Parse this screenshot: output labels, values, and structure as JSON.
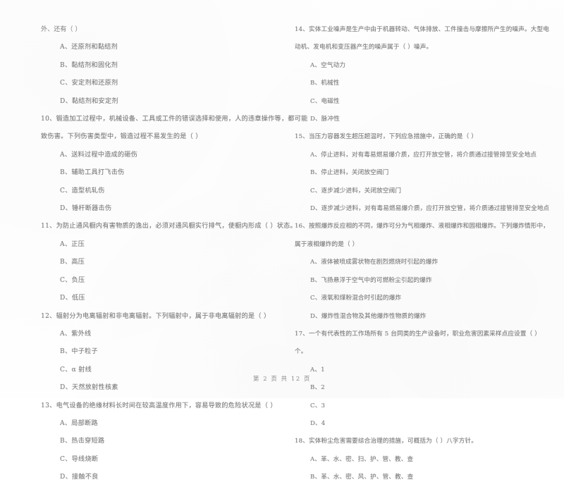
{
  "document": {
    "type": "scanned-exam-paper",
    "language": "zh-CN",
    "page_label": "第 2 页 共 12 页",
    "ink_color": "#7e7e7e",
    "paper_color": "#fefefe"
  },
  "left_column": {
    "carryover": {
      "text": "外、还有（      ）",
      "options": [
        "A、还原剂和黏结剂",
        "B、黏结剂和固化剂",
        "C、安定剂和还原剂",
        "D、黏结剂和安定剂"
      ]
    },
    "questions": [
      {
        "number": "10",
        "stem_lines": [
          "10、锻造加工过程中，机械设备、工具或工件的错误选择和使用，人的违章操作等，都可能",
          "致伤害。下列伤害类型中，锻造过程不易发生的是（      ）"
        ],
        "options": [
          "A、送料过程中造成的砸伤",
          "B、辅助工具打飞击伤",
          "C、造型机轧伤",
          "D、锤杆断器击伤"
        ]
      },
      {
        "number": "11",
        "stem_lines": [
          "11、为防止通风橱内有害物质的逸出，必须对通风橱实行排气，使橱内形成（     ）状态。"
        ],
        "options": [
          "A、正压",
          "B、高压",
          "C、负压",
          "D、低压"
        ]
      },
      {
        "number": "12",
        "stem_lines": [
          "12、辐射分为电离辐射和非电离辐射。下列辐射中，属于非电离辐射的是（      ）"
        ],
        "options": [
          "A、紫外线",
          "B、中子粒子",
          "C、α 射线",
          "D、天然放射性核素"
        ]
      },
      {
        "number": "13",
        "stem_lines": [
          "13、电气设备的绝缘材料长时间在较高温度作用下，容易导致的危险状况是（      ）"
        ],
        "options": [
          "A、局部断路",
          "B、热击穿短路",
          "C、导线烧断",
          "D、接触不良"
        ]
      }
    ]
  },
  "right_column": {
    "questions": [
      {
        "number": "14",
        "stem_lines": [
          "14、实体工业噪声是生产中由于机器转动、气体排放、工件撞击与摩擦所产生的噪声。大型电",
          "动机、发电机和变压器产生的噪声属于（     ）噪声。"
        ],
        "options": [
          "A、空气动力",
          "B、机械性",
          "C、电磁性",
          "D、脉冲性"
        ]
      },
      {
        "number": "15",
        "stem_lines": [
          "15、当压力容器发生超压超温时，下列应急措施中，正确的是（     ）"
        ],
        "options": [
          "A、停止进料，对有毒易燃易爆介质，应打开放空管，将介质通过接管排至安全地点",
          "B、停止进料，关闭放空阀门",
          "C、逐步减少进料，关闭放空阀门",
          "D、逐步减少进料，对有毒易燃易爆介质，应打开放空管，将介质通过接管排至安全地点"
        ]
      },
      {
        "number": "16",
        "stem_lines": [
          "16、按照爆炸反应相的不同，爆炸可分为气相爆炸、液相爆炸和固相爆炸。下列爆炸情形中，",
          "属于液相爆炸的是（     ）"
        ],
        "options": [
          "A、液体被喷成雾状物在剧烈燃烧时引起的爆炸",
          "B、飞扬悬浮于空气中的可燃粉尘引起的爆炸",
          "C、液氧和煤粉混合时引起的爆炸",
          "D、爆炸性混合物及其他爆炸性物质的爆炸"
        ]
      },
      {
        "number": "17",
        "stem_lines": [
          "17、一个有代表性的工作场所有 5 台同类的生产设备时，职业危害因素采样点应设置（      ）",
          "个。"
        ],
        "options": [
          "A、1",
          "B、2",
          "C、3",
          "D、4"
        ]
      },
      {
        "number": "18",
        "stem_lines": [
          "18、实体粉尘危害需要综合治理的措施，可概括为（     ）八字方针。"
        ],
        "options": [
          "A、革、水、密、扫、护、管、教、查",
          "B、革、水、密、风、护、管、教、查"
        ]
      }
    ]
  }
}
